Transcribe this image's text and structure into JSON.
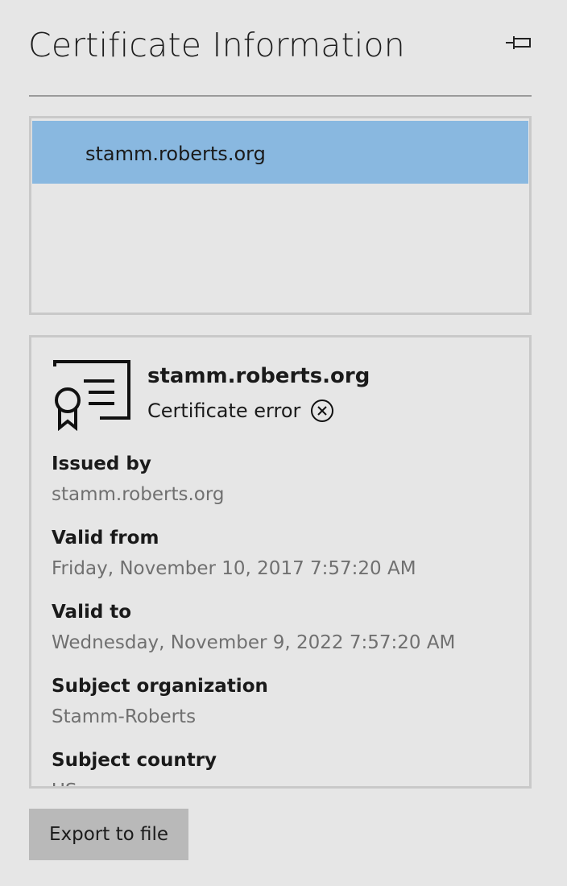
{
  "panel": {
    "title": "Certificate Information",
    "pin_icon": "pin-icon"
  },
  "certificate_list": {
    "items": [
      {
        "label": "stamm.roberts.org",
        "selected": true
      }
    ],
    "selected_color": "#89b8e0"
  },
  "details": {
    "icon": "certificate-icon",
    "subject_name": "stamm.roberts.org",
    "status": {
      "text": "Certificate error",
      "icon": "error-circle-x-icon"
    },
    "fields": [
      {
        "label": "Issued by",
        "value": "stamm.roberts.org"
      },
      {
        "label": "Valid from",
        "value": "Friday, November 10, 2017 7:57:20 AM"
      },
      {
        "label": "Valid to",
        "value": "Wednesday, November 9, 2022 7:57:20 AM"
      },
      {
        "label": "Subject organization",
        "value": "Stamm-Roberts"
      },
      {
        "label": "Subject country",
        "value": "US"
      }
    ]
  },
  "actions": {
    "export_label": "Export to file"
  }
}
